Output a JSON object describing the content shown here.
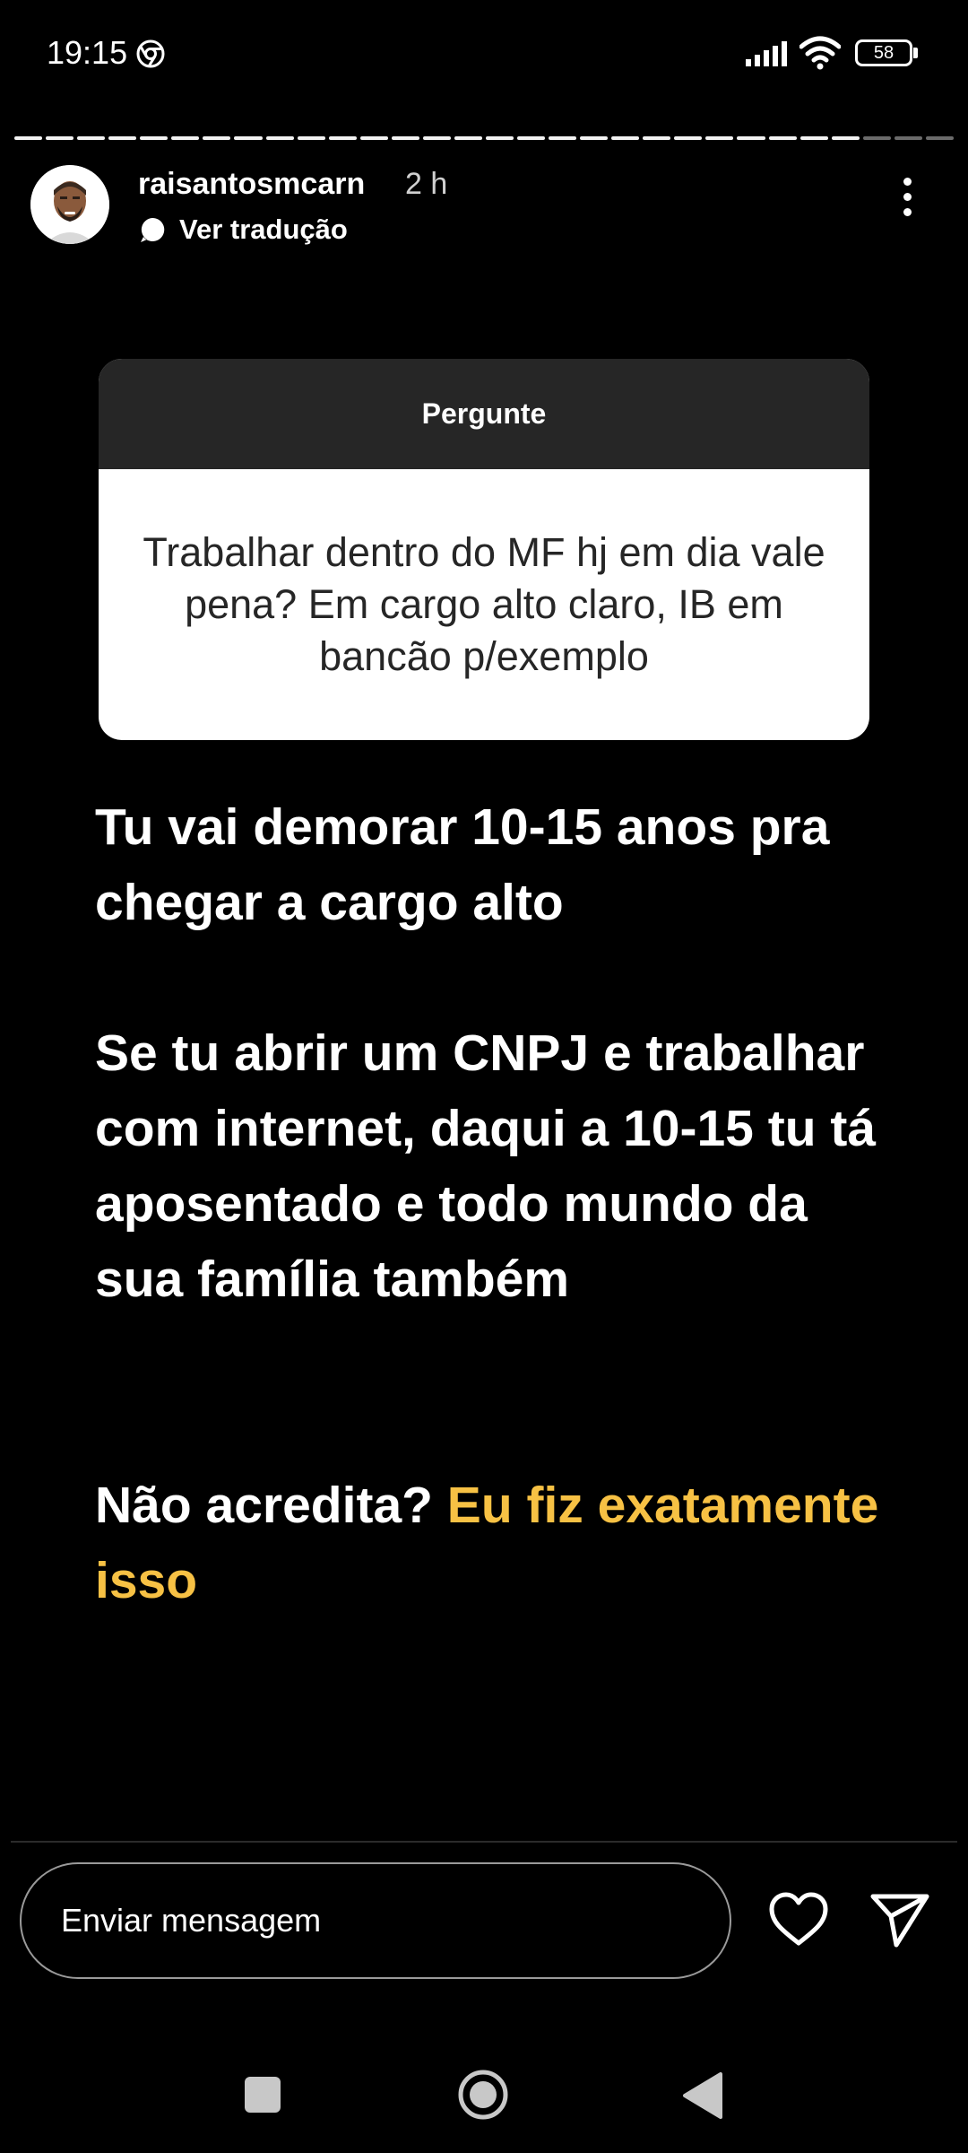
{
  "status_bar": {
    "time": "19:15",
    "battery": "58",
    "icons": [
      "chrome-icon",
      "signal-icon",
      "wifi-icon",
      "battery-icon"
    ]
  },
  "story": {
    "segments_total": 30,
    "segments_viewed": 27,
    "username": "raisantosmcarn",
    "time_ago": "2 h",
    "translate_label": "Ver tradução"
  },
  "question_card": {
    "header": "Pergunte",
    "question": "Trabalhar dentro do MF hj em dia vale pena? Em cargo alto claro, IB em bancão p/exemplo"
  },
  "answer": {
    "paragraph_1": "Tu vai demorar 10-15 anos pra chegar a cargo alto",
    "paragraph_2": "Se tu abrir um CNPJ e trabalhar com internet, daqui a 10-15 tu tá aposentado e todo mundo da sua família também",
    "paragraph_3_white": "Não acredita? ",
    "paragraph_3_highlight": "Eu fiz exatamente isso"
  },
  "reply": {
    "placeholder": "Enviar mensagem"
  },
  "colors": {
    "background": "#000000",
    "highlight": "#f7c144",
    "card_header": "#262626"
  }
}
